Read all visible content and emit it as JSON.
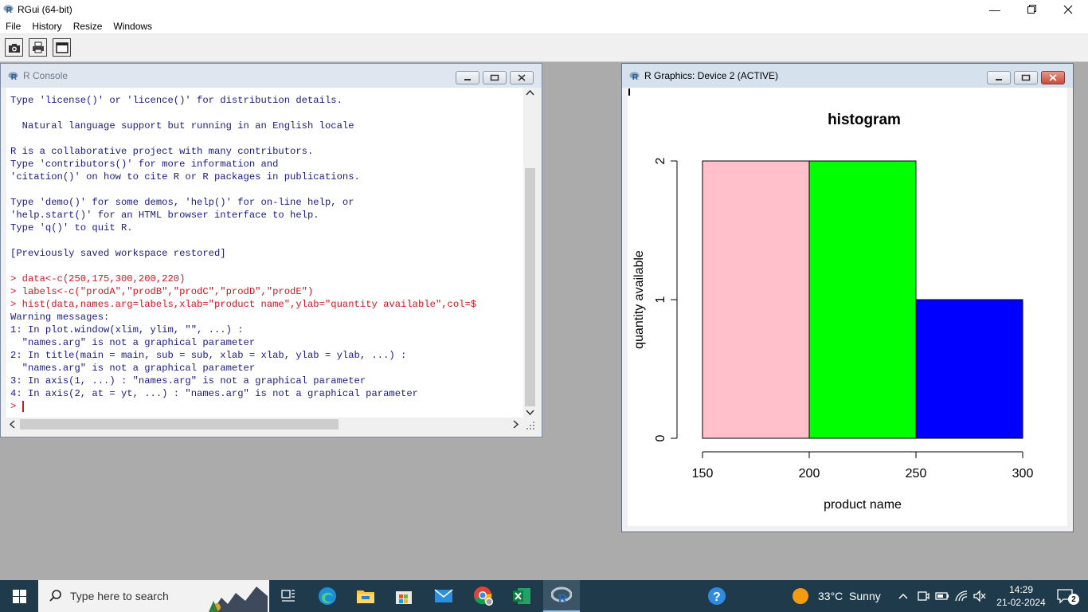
{
  "app": {
    "title": "RGui (64-bit)"
  },
  "menu": [
    "File",
    "History",
    "Resize",
    "Windows"
  ],
  "console": {
    "title": "R Console",
    "lines": [
      {
        "text": "Type 'license()' or 'licence()' for distribution details.",
        "kind": "out"
      },
      {
        "text": "",
        "kind": "out"
      },
      {
        "text": "  Natural language support but running in an English locale",
        "kind": "out"
      },
      {
        "text": "",
        "kind": "out"
      },
      {
        "text": "R is a collaborative project with many contributors.",
        "kind": "out"
      },
      {
        "text": "Type 'contributors()' for more information and",
        "kind": "out"
      },
      {
        "text": "'citation()' on how to cite R or R packages in publications.",
        "kind": "out"
      },
      {
        "text": "",
        "kind": "out"
      },
      {
        "text": "Type 'demo()' for some demos, 'help()' for on-line help, or",
        "kind": "out"
      },
      {
        "text": "'help.start()' for an HTML browser interface to help.",
        "kind": "out"
      },
      {
        "text": "Type 'q()' to quit R.",
        "kind": "out"
      },
      {
        "text": "",
        "kind": "out"
      },
      {
        "text": "[Previously saved workspace restored]",
        "kind": "out"
      },
      {
        "text": "",
        "kind": "out"
      },
      {
        "text": "> data<-c(250,175,300,200,220)",
        "kind": "in"
      },
      {
        "text": "> labels<-c(\"prodA\",\"prodB\",\"prodC\",\"prodD\",\"prodE\")",
        "kind": "in"
      },
      {
        "text": "> hist(data,names.arg=labels,xlab=\"product name\",ylab=\"quantity available\",col=$",
        "kind": "in"
      },
      {
        "text": "Warning messages:",
        "kind": "out"
      },
      {
        "text": "1: In plot.window(xlim, ylim, \"\", ...) :",
        "kind": "out"
      },
      {
        "text": "  \"names.arg\" is not a graphical parameter",
        "kind": "out"
      },
      {
        "text": "2: In title(main = main, sub = sub, xlab = xlab, ylab = ylab, ...) :",
        "kind": "out"
      },
      {
        "text": "  \"names.arg\" is not a graphical parameter",
        "kind": "out"
      },
      {
        "text": "3: In axis(1, ...) : \"names.arg\" is not a graphical parameter",
        "kind": "out"
      },
      {
        "text": "4: In axis(2, at = yt, ...) : \"names.arg\" is not a graphical parameter",
        "kind": "out"
      },
      {
        "text": "> ",
        "kind": "in"
      }
    ]
  },
  "graphics": {
    "title": "R Graphics: Device 2 (ACTIVE)"
  },
  "chart_data": {
    "type": "bar",
    "title": "histogram",
    "xlabel": "product name",
    "ylabel": "quantity available",
    "bins": [
      [
        150,
        200
      ],
      [
        200,
        250
      ],
      [
        250,
        300
      ]
    ],
    "values": [
      2,
      2,
      1
    ],
    "colors": [
      "#ffc0cb",
      "#00ff00",
      "#0000ff"
    ],
    "x_ticks": [
      "150",
      "200",
      "250",
      "300"
    ],
    "y_ticks": [
      "0",
      "1",
      "2"
    ],
    "xlim": [
      150,
      300
    ],
    "ylim": [
      0,
      2
    ],
    "grid": false
  },
  "taskbar": {
    "search_placeholder": "Type here to search",
    "weather": "33°C  Sunny",
    "time": "14:29",
    "date": "21-02-2024",
    "notifications": "2"
  }
}
